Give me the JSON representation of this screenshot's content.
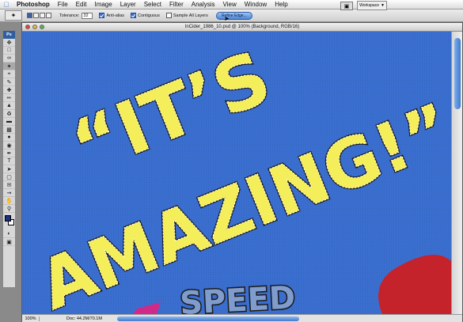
{
  "menubar": {
    "apple_icon": "apple-icon",
    "app_name": "Photoshop",
    "items": [
      "File",
      "Edit",
      "Image",
      "Layer",
      "Select",
      "Filter",
      "Analysis",
      "View",
      "Window",
      "Help"
    ]
  },
  "options": {
    "tolerance_label": "Tolerance:",
    "tolerance_value": "32",
    "anti_alias_label": "Anti-alias",
    "anti_alias_checked": true,
    "contiguous_label": "Contiguous",
    "contiguous_checked": true,
    "sample_all_label": "Sample All Layers",
    "sample_all_checked": false,
    "refine_edge_label": "Refine Edge...",
    "workspace_label": "Workspace"
  },
  "toolbox": {
    "logo": "Ps",
    "tools": [
      "move",
      "marquee",
      "lasso",
      "magic-wand",
      "crop",
      "slice",
      "healing",
      "brush",
      "stamp",
      "history-brush",
      "eraser",
      "gradient",
      "blur",
      "dodge",
      "pen",
      "type",
      "path-select",
      "shape",
      "notes",
      "eyedropper",
      "hand",
      "zoom"
    ],
    "foreground_color": "#1c2f7c",
    "background_color": "#ffffff"
  },
  "document": {
    "title": "InCider_1986_10.psd @ 100% (Background, RGB/16)",
    "zoom": "100%",
    "doc_size": "Doc: 44.2M/70.1M",
    "artwork": {
      "line1": "“IT’S",
      "line2": "AMAZING!”",
      "line3": "SPEED",
      "canvas_color": "#3b6fcf",
      "text_color": "#f4ee5a"
    }
  }
}
